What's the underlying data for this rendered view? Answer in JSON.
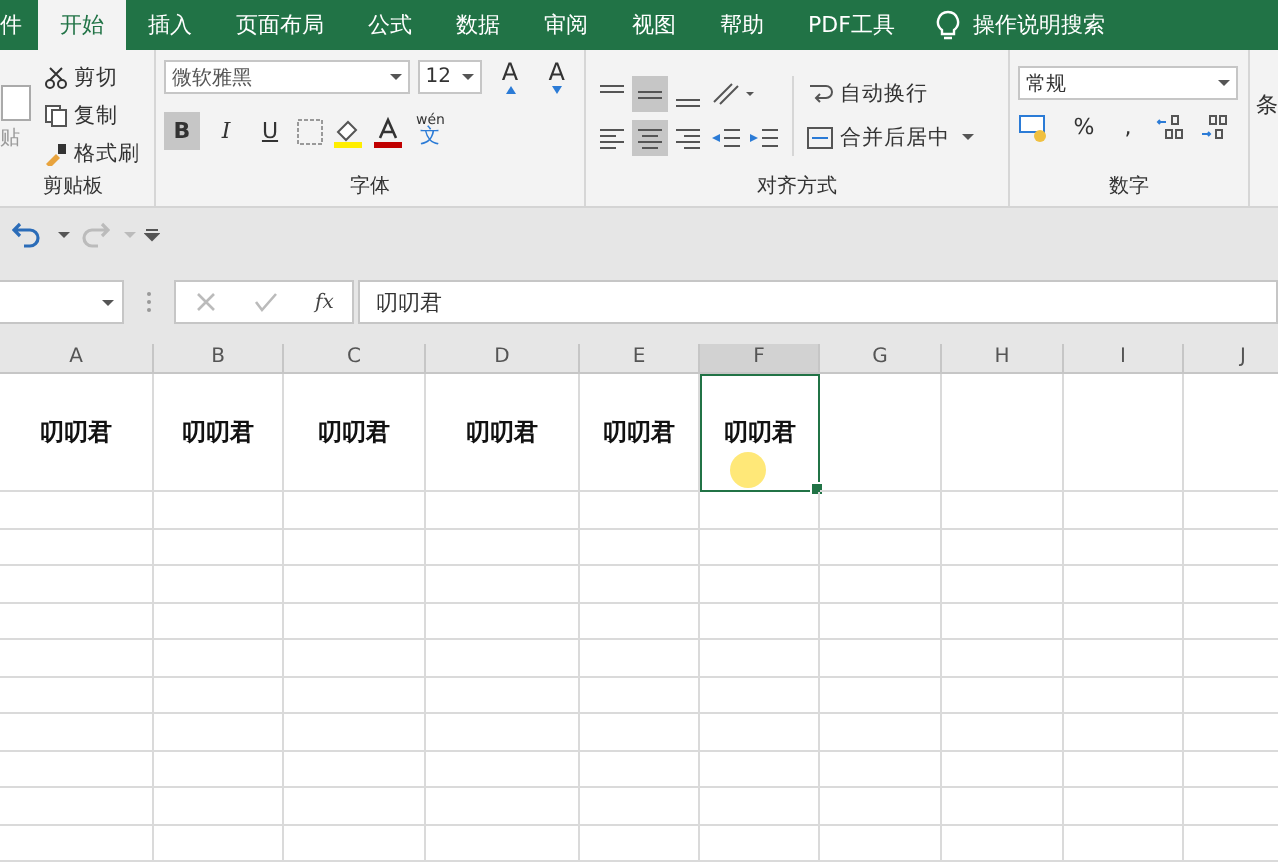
{
  "tabs": [
    {
      "label": "件",
      "selected": false
    },
    {
      "label": "开始",
      "selected": true
    },
    {
      "label": "插入",
      "selected": false
    },
    {
      "label": "页面布局",
      "selected": false
    },
    {
      "label": "公式",
      "selected": false
    },
    {
      "label": "数据",
      "selected": false
    },
    {
      "label": "审阅",
      "selected": false
    },
    {
      "label": "视图",
      "selected": false
    },
    {
      "label": "帮助",
      "selected": false
    },
    {
      "label": "PDF工具",
      "selected": false
    }
  ],
  "tell_me": {
    "label": "操作说明搜索"
  },
  "ribbon": {
    "clipboard": {
      "paste_label": "贴",
      "cut": "剪切",
      "copy": "复制",
      "format_painter": "格式刷",
      "group_label": "剪贴板"
    },
    "font": {
      "name": "微软雅黑",
      "size": "12",
      "grow": "A",
      "shrink": "A",
      "bold": {
        "label": "B",
        "pressed": true
      },
      "italic": {
        "label": "I",
        "pressed": false
      },
      "underline": {
        "label": "U",
        "pressed": false
      },
      "phonetic_top": "wén",
      "phonetic_bottom": "文",
      "group_label": "字体"
    },
    "alignment": {
      "middle_align_pressed": true,
      "center_pressed": true,
      "wrap_text": "自动换行",
      "merge_center": "合并后居中",
      "group_label": "对齐方式"
    },
    "number": {
      "format": "常规",
      "percent": "%",
      "comma": ",",
      "group_label": "数字"
    },
    "styles_partial": "条"
  },
  "formula_bar": {
    "fx": "fx",
    "value": "叨叨君"
  },
  "columns": [
    {
      "label": "A",
      "selected": false,
      "cell_1": "叨叨君"
    },
    {
      "label": "B",
      "selected": false,
      "cell_1": "叨叨君"
    },
    {
      "label": "C",
      "selected": false,
      "cell_1": "叨叨君"
    },
    {
      "label": "D",
      "selected": false,
      "cell_1": "叨叨君"
    },
    {
      "label": "E",
      "selected": false,
      "cell_1": "叨叨君"
    },
    {
      "label": "F",
      "selected": true,
      "cell_1": "叨叨君"
    },
    {
      "label": "G",
      "selected": false
    },
    {
      "label": "H",
      "selected": false
    },
    {
      "label": "I",
      "selected": false
    },
    {
      "label": "J",
      "selected": false
    }
  ]
}
